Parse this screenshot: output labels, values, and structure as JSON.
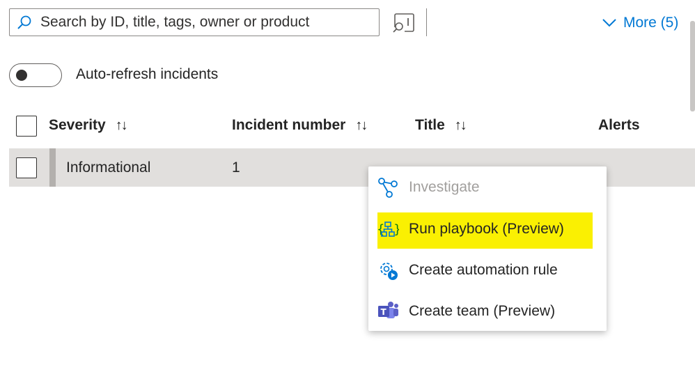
{
  "search": {
    "placeholder": "Search by ID, title, tags, owner or product"
  },
  "more": {
    "label": "More (5)"
  },
  "auto_refresh": {
    "label": "Auto-refresh incidents",
    "enabled": false
  },
  "table": {
    "columns": [
      {
        "label": "Severity",
        "sort": "↑↓"
      },
      {
        "label": "Incident number",
        "sort": "↑↓"
      },
      {
        "label": "Title",
        "sort": "↑↓"
      },
      {
        "label": "Alerts"
      }
    ],
    "rows": [
      {
        "severity": "Informational",
        "number": "1"
      }
    ]
  },
  "context_menu": {
    "items": [
      {
        "label": "Investigate",
        "icon": "investigate-icon",
        "disabled": true
      },
      {
        "label": "Run playbook (Preview)",
        "icon": "playbook-icon",
        "highlighted": true
      },
      {
        "label": "Create automation rule",
        "icon": "automation-gear-icon"
      },
      {
        "label": "Create team (Preview)",
        "icon": "teams-icon"
      }
    ]
  },
  "colors": {
    "accent": "#0078d4",
    "highlight": "#faf002",
    "row_selected": "#e1dfdd"
  }
}
